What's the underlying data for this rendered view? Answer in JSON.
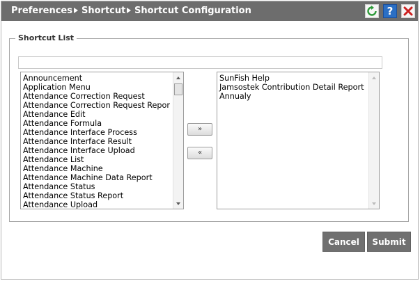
{
  "breadcrumb": {
    "items": [
      "Preferences",
      "Shortcut",
      "Shortcut Configuration"
    ]
  },
  "toolbar": {
    "refresh_icon": "refresh-icon",
    "help_label": "?",
    "close_icon": "close-icon",
    "colors": {
      "title_bar": "#6d6d6d",
      "refresh": "#2e9a3a",
      "help": "#2b6fc4",
      "close": "#cc1f1f"
    }
  },
  "shortcut_list": {
    "legend": "Shortcut List",
    "search_value": "",
    "available": [
      "Announcement",
      "Application Menu",
      "Attendance Correction Request",
      "Attendance Correction Request Repor",
      "Attendance Edit",
      "Attendance Formula",
      "Attendance Interface Process",
      "Attendance Interface Result",
      "Attendance Interface Upload",
      "Attendance List",
      "Attendance Machine",
      "Attendance Machine Data Report",
      "Attendance Status",
      "Attendance Status Report",
      "Attendance Upload"
    ],
    "selected": [
      "SunFish Help",
      "Jamsostek Contribution Detail Report",
      "Annualy"
    ],
    "add_label": "»",
    "remove_label": "«"
  },
  "actions": {
    "cancel_label": "Cancel",
    "submit_label": "Submit"
  }
}
